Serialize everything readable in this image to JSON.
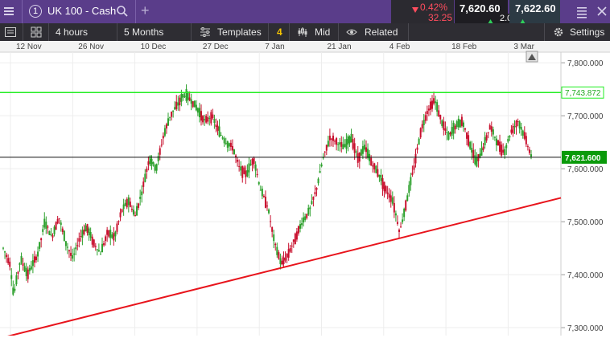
{
  "window": {
    "tab_number": "1",
    "instrument": "UK 100 - Cash",
    "add_tab_symbol": "+"
  },
  "quote": {
    "change_percent": "0.42%",
    "change_points": "32.25",
    "sell_price": "7,620.60",
    "buy_price": "7,622.60",
    "spread": "2.00",
    "change_color": "#ff4d5e",
    "up_color": "#2fd05a"
  },
  "toolbar": {
    "interval": "4 hours",
    "range": "5 Months",
    "templates_label": "Templates",
    "templates_count": "4",
    "price_type": "Mid",
    "related_label": "Related",
    "settings_label": "Settings"
  },
  "chart_data": {
    "type": "candlestick",
    "x_tick_labels": [
      "12 Nov",
      "26 Nov",
      "10 Dec",
      "27 Dec",
      "7 Jan",
      "21 Jan",
      "4 Feb",
      "18 Feb",
      "3 Mar"
    ],
    "y_tick_labels": [
      "7,800.000",
      "7,700.000",
      "7,600.000",
      "7,500.000",
      "7,400.000",
      "7,300.000"
    ],
    "ylim": [
      7285,
      7820
    ],
    "grid": true,
    "series": [
      {
        "name": "price",
        "points": [
          [
            0,
            7450
          ],
          [
            2,
            7420
          ],
          [
            3,
            7360
          ],
          [
            5,
            7430
          ],
          [
            7,
            7400
          ],
          [
            10,
            7440
          ],
          [
            12,
            7500
          ],
          [
            14,
            7470
          ],
          [
            16,
            7510
          ],
          [
            18,
            7460
          ],
          [
            20,
            7430
          ],
          [
            22,
            7470
          ],
          [
            24,
            7490
          ],
          [
            26,
            7460
          ],
          [
            28,
            7440
          ],
          [
            30,
            7480
          ],
          [
            32,
            7470
          ],
          [
            34,
            7520
          ],
          [
            36,
            7540
          ],
          [
            38,
            7510
          ],
          [
            40,
            7560
          ],
          [
            42,
            7620
          ],
          [
            44,
            7600
          ],
          [
            46,
            7660
          ],
          [
            48,
            7700
          ],
          [
            50,
            7720
          ],
          [
            52,
            7740
          ],
          [
            54,
            7730
          ],
          [
            56,
            7710
          ],
          [
            58,
            7690
          ],
          [
            60,
            7700
          ],
          [
            62,
            7670
          ],
          [
            64,
            7650
          ],
          [
            66,
            7640
          ],
          [
            68,
            7600
          ],
          [
            70,
            7590
          ],
          [
            72,
            7620
          ],
          [
            74,
            7560
          ],
          [
            76,
            7530
          ],
          [
            78,
            7460
          ],
          [
            80,
            7420
          ],
          [
            82,
            7440
          ],
          [
            84,
            7470
          ],
          [
            86,
            7500
          ],
          [
            88,
            7520
          ],
          [
            90,
            7560
          ],
          [
            92,
            7620
          ],
          [
            94,
            7660
          ],
          [
            96,
            7650
          ],
          [
            98,
            7640
          ],
          [
            100,
            7660
          ],
          [
            102,
            7620
          ],
          [
            104,
            7640
          ],
          [
            106,
            7610
          ],
          [
            108,
            7590
          ],
          [
            110,
            7560
          ],
          [
            112,
            7540
          ],
          [
            114,
            7480
          ],
          [
            116,
            7540
          ],
          [
            118,
            7600
          ],
          [
            120,
            7670
          ],
          [
            122,
            7710
          ],
          [
            124,
            7730
          ],
          [
            126,
            7690
          ],
          [
            128,
            7660
          ],
          [
            130,
            7680
          ],
          [
            132,
            7690
          ],
          [
            134,
            7650
          ],
          [
            136,
            7610
          ],
          [
            138,
            7640
          ],
          [
            140,
            7680
          ],
          [
            142,
            7650
          ],
          [
            144,
            7630
          ],
          [
            146,
            7670
          ],
          [
            148,
            7690
          ],
          [
            150,
            7660
          ],
          [
            152,
            7621
          ]
        ]
      }
    ],
    "annotations": [
      {
        "type": "horizontal",
        "value": 7743.872,
        "label": "7,743.872",
        "color": "#22ee22"
      },
      {
        "type": "current-price",
        "value": 7621.6,
        "label": "7,621.600",
        "color": "#0a9a0a"
      },
      {
        "type": "trendline",
        "from": [
          0,
          7280
        ],
        "to": [
          152,
          7545
        ],
        "color": "#e8141c"
      }
    ],
    "colors": {
      "up": "#2ca02c",
      "down": "#c8102e"
    }
  }
}
